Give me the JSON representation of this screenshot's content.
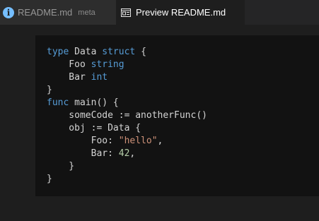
{
  "tabs": [
    {
      "label": "README.md",
      "meta": "meta",
      "icon": "info-icon",
      "active": false
    },
    {
      "label": "Preview README.md",
      "icon": "preview-icon",
      "active": true
    }
  ],
  "code_lines": [
    [
      {
        "t": "kw",
        "v": "type"
      },
      {
        "t": "txt",
        "v": " Data "
      },
      {
        "t": "kw",
        "v": "struct"
      },
      {
        "t": "txt",
        "v": " {"
      }
    ],
    [
      {
        "t": "txt",
        "v": "    Foo "
      },
      {
        "t": "kw",
        "v": "string"
      }
    ],
    [
      {
        "t": "txt",
        "v": "    Bar "
      },
      {
        "t": "kw",
        "v": "int"
      }
    ],
    [
      {
        "t": "txt",
        "v": "}"
      }
    ],
    [
      {
        "t": "kw",
        "v": "func"
      },
      {
        "t": "txt",
        "v": " main() {"
      }
    ],
    [
      {
        "t": "txt",
        "v": "    someCode := anotherFunc()"
      }
    ],
    [
      {
        "t": "txt",
        "v": "    obj := Data {"
      }
    ],
    [
      {
        "t": "txt",
        "v": "        Foo: "
      },
      {
        "t": "str",
        "v": "\"hello\""
      },
      {
        "t": "txt",
        "v": ","
      }
    ],
    [
      {
        "t": "txt",
        "v": "        Bar: "
      },
      {
        "t": "num",
        "v": "42"
      },
      {
        "t": "txt",
        "v": ","
      }
    ],
    [
      {
        "t": "txt",
        "v": "    }"
      }
    ],
    [
      {
        "t": "txt",
        "v": "}"
      }
    ]
  ],
  "colors": {
    "keyword": "#569cd6",
    "string": "#ce9178",
    "number": "#b5cea8",
    "text": "#d4d4d4",
    "info_icon": "#75beff"
  }
}
